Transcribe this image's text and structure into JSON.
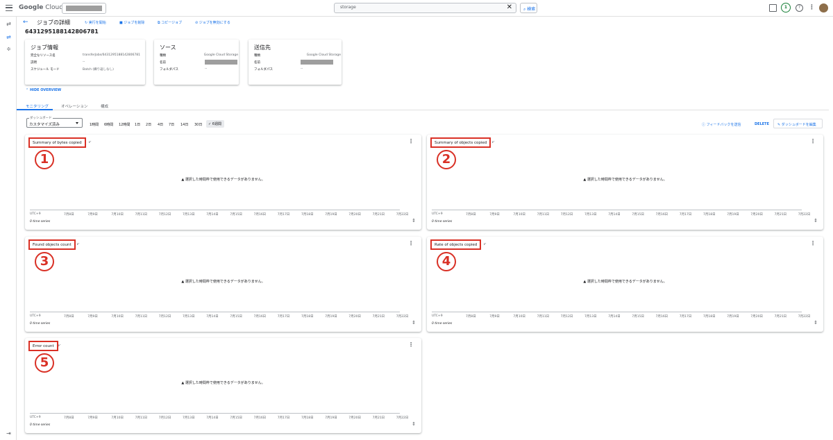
{
  "topbar": {
    "logo_prefix": "Google",
    "logo_suffix": " Cloud",
    "search_value": "storage",
    "search_button": "検索",
    "clear_glyph": "✕",
    "notification_count": "1",
    "help_glyph": "?",
    "kebab_glyph": "⋮"
  },
  "sidebar": {
    "icon1": "⇄",
    "icon2": "⇌",
    "icon3": "≑",
    "expand": "⇥"
  },
  "header": {
    "back": "←",
    "title": "ジョブの詳細",
    "actions": [
      "実行を開始",
      "ジョブを削除",
      "コピージョブ",
      "ジョブを無効にする"
    ],
    "job_id": "6431295188142806781"
  },
  "cards": [
    {
      "title": "ジョブ情報",
      "rows": [
        {
          "k": "完全なリソース名",
          "v": "transferJobs/6431295188142806781"
        },
        {
          "k": "説明",
          "v": "--"
        },
        {
          "k": "スケジュール モード",
          "v": "Batch (繰り返しなし)"
        }
      ]
    },
    {
      "title": "ソース",
      "rows": [
        {
          "k": "種類",
          "v": "Google Cloud Storage"
        },
        {
          "k": "名前",
          "v": ""
        },
        {
          "k": "フォルダパス",
          "v": "--"
        }
      ]
    },
    {
      "title": "送信先",
      "rows": [
        {
          "k": "種類",
          "v": "Google Cloud Storage"
        },
        {
          "k": "名前",
          "v": ""
        },
        {
          "k": "フォルダパス",
          "v": "--"
        }
      ]
    }
  ],
  "hide_overview": "HIDE OVERVIEW",
  "tabs": [
    "モニタリング",
    "オペレーション",
    "構成"
  ],
  "dashboard": {
    "label": "ダッシュボード",
    "value": "カスタマイズ済み"
  },
  "time_ranges": [
    "1時間",
    "6時間",
    "12時間",
    "1日",
    "2日",
    "4日",
    "7日",
    "14日",
    "30日",
    "6週間"
  ],
  "selected_range_check": "✓",
  "feedback": "フィードバックを送信",
  "delete": "DELETE",
  "edit": "ダッシュボードを編集",
  "panels": [
    {
      "title": "Summary of bytes copied",
      "num": "1"
    },
    {
      "title": "Summary of objects copied",
      "num": "2"
    },
    {
      "title": "Found objects count",
      "num": "3"
    },
    {
      "title": "Rate of objects copied",
      "num": "4"
    },
    {
      "title": "Error count",
      "num": "5"
    }
  ],
  "panel_common": {
    "no_data": "選択した時間枠で使用できるデータがありません。",
    "utc": "UTC+9",
    "series": "0 time series",
    "dates": [
      "7月8日",
      "7月9日",
      "7月10日",
      "7月11日",
      "7月12日",
      "7月13日",
      "7月14日",
      "7月15日",
      "7月16日",
      "7月17日",
      "7月18日",
      "7月19日",
      "7月20日",
      "7月21日",
      "7月22日"
    ],
    "menu": "⋮",
    "warn": "▲",
    "legend_icon": "⩗",
    "sort": "⇕"
  },
  "colors": {
    "accent": "#1a73e8",
    "annotation": "#d93025"
  }
}
